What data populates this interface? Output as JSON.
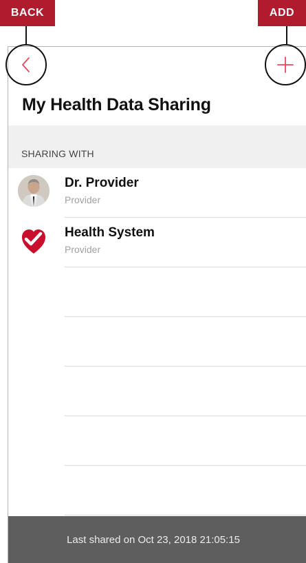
{
  "annotations": {
    "back_label": "BACK",
    "add_label": "ADD",
    "callout_color": "#b01c2e"
  },
  "header": {
    "back_icon": "chevron-left-icon",
    "add_icon": "plus-icon",
    "accent_color": "#e8485e",
    "title": "My Health Data Sharing"
  },
  "sharing": {
    "section_label": "SHARING WITH",
    "items": [
      {
        "name": "Dr. Provider",
        "role": "Provider",
        "icon": "provider-photo"
      },
      {
        "name": "Health System",
        "role": "Provider",
        "icon": "health-system-logo-icon"
      }
    ]
  },
  "footer": {
    "last_shared": "Last shared on Oct 23, 2018 21:05:15"
  }
}
